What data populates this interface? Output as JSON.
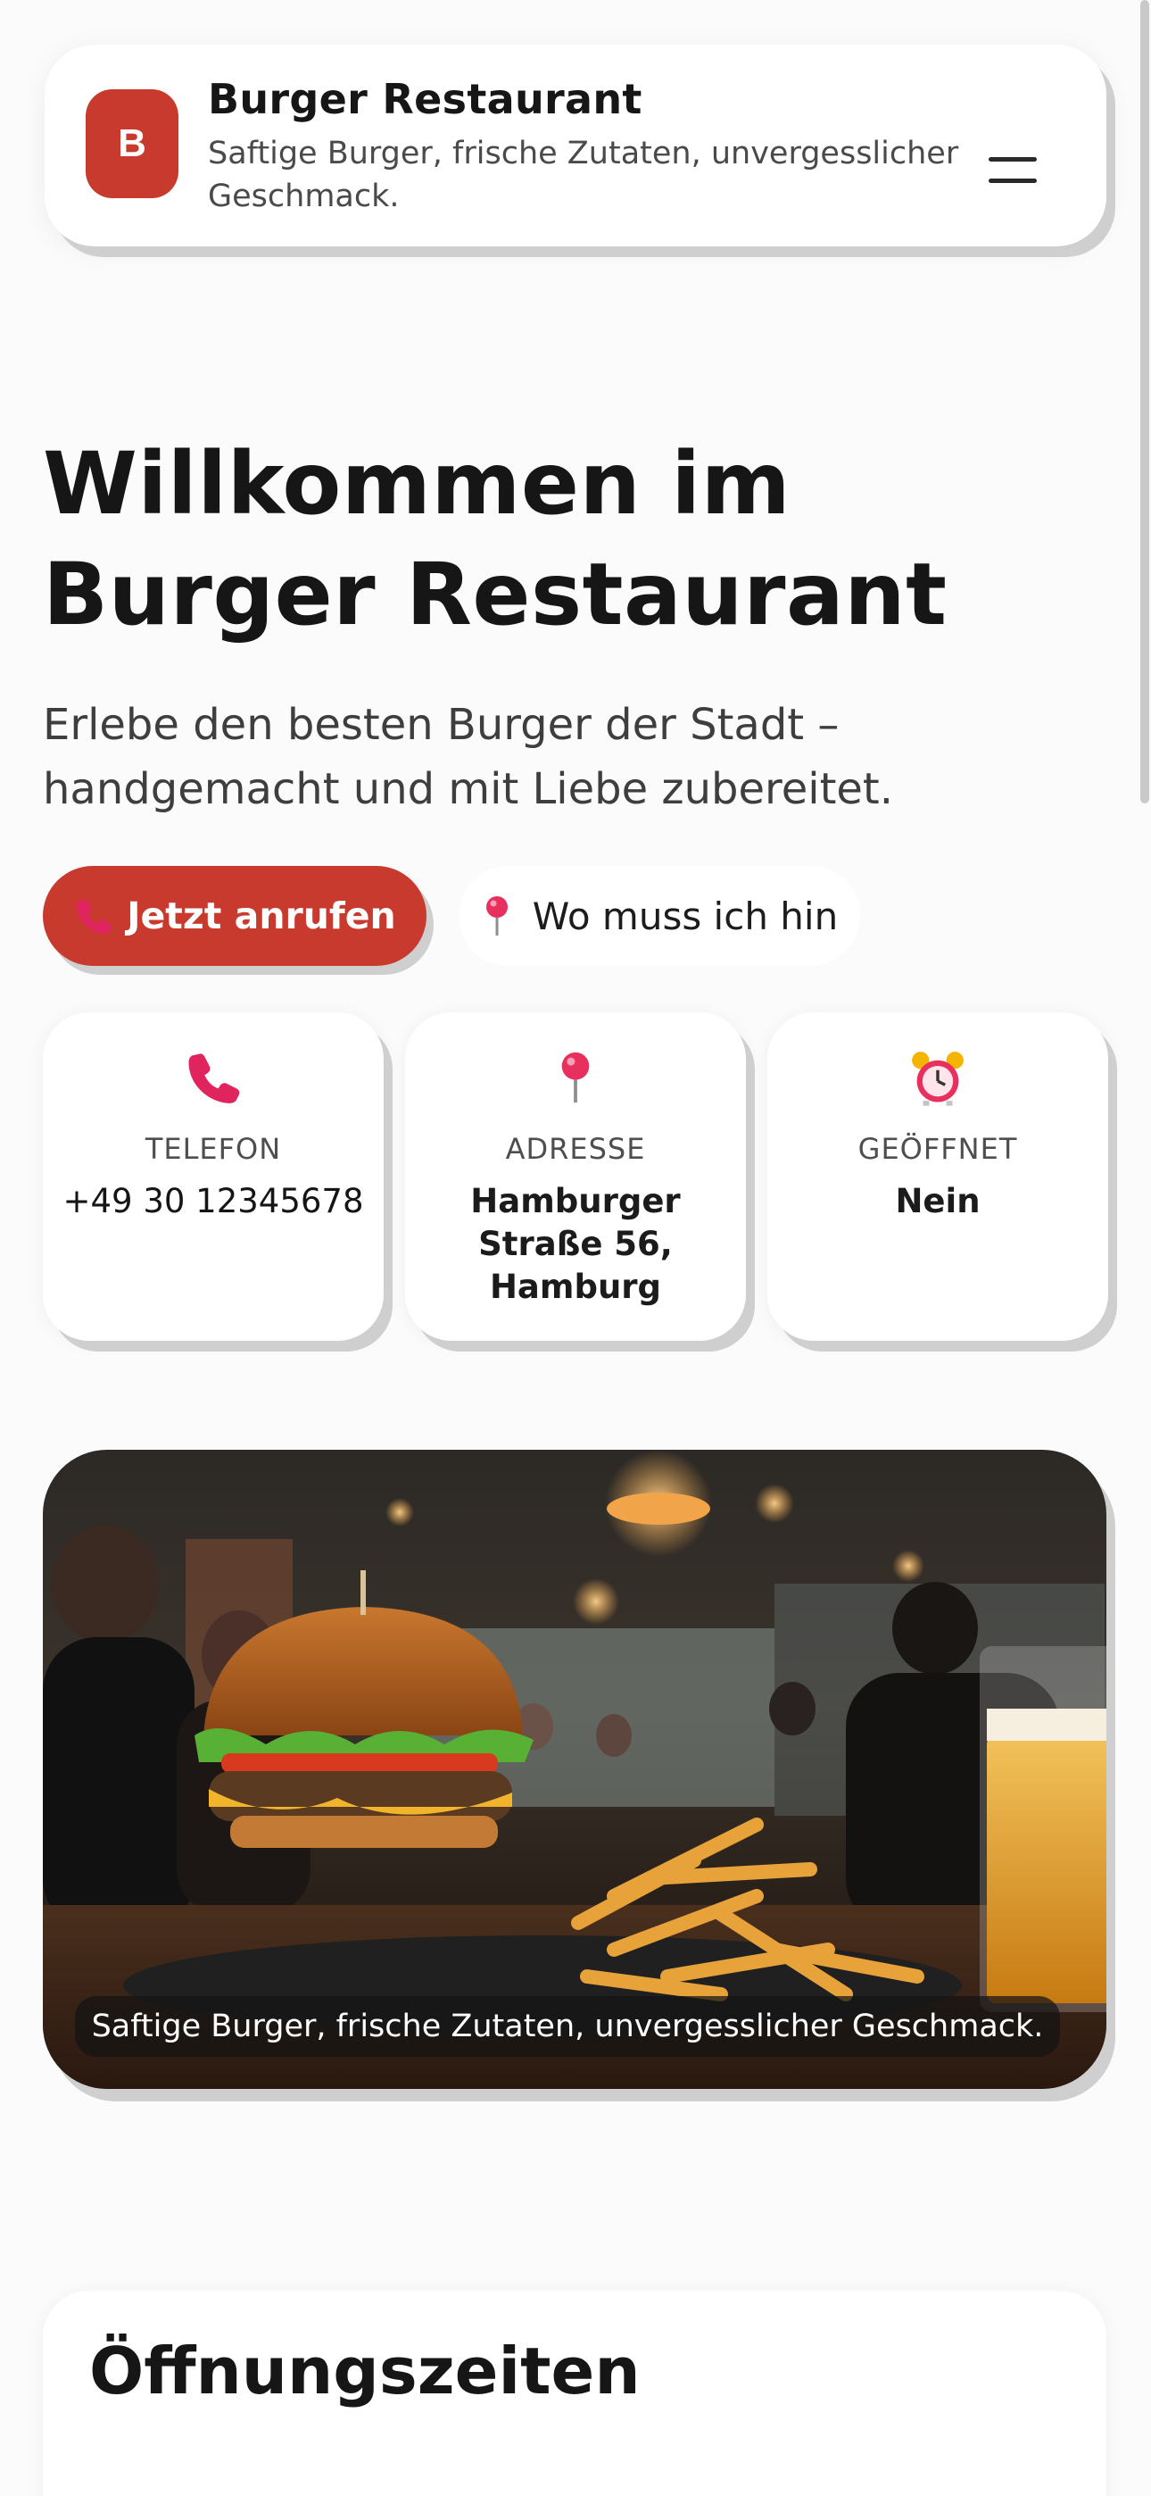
{
  "header": {
    "logo_letter": "B",
    "title": "Burger Restaurant",
    "subtitle": "Saftige Burger, frische Zutaten, unvergesslicher Geschmack.",
    "menu_icon": "hamburger-menu-icon"
  },
  "hero": {
    "title": "Willkommen im Burger Restaurant",
    "subtitle": "Erlebe den besten Burger der Stadt – handgemacht und mit Liebe zubereitet.",
    "call_button": {
      "icon": "telephone-icon",
      "label": "Jetzt anrufen"
    },
    "route_button": {
      "icon": "pin-icon",
      "label": "Wo muss ich hin"
    }
  },
  "info_cards": [
    {
      "icon": "telephone-icon",
      "label": "TELEFON",
      "value": "+49 30 12345678"
    },
    {
      "icon": "pin-icon",
      "label": "ADRESSE",
      "value": "Hamburger Straße 56, Hamburg"
    },
    {
      "icon": "alarm-clock-icon",
      "label": "GEÖFFNET",
      "value": "Nein"
    }
  ],
  "photo": {
    "caption": "Saftige Burger, frische Zutaten, unvergesslicher Geschmack."
  },
  "hours": {
    "title": "Öffnungszeiten"
  },
  "colors": {
    "accent": "#c93a2e",
    "background": "#fbfbfb",
    "card": "#ffffff",
    "text": "#161616"
  }
}
